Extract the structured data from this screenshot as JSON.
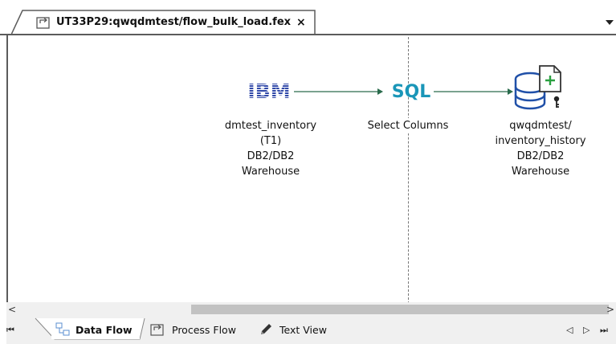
{
  "document_tab": {
    "title": "UT33P29:qwqdmtest/flow_bulk_load.fex",
    "close_label": "×",
    "icon": "flow-document-icon"
  },
  "strip_dropdown": "▾",
  "flow": {
    "source": {
      "icon": "ibm-db2-logo-icon",
      "logo_text": "IBM",
      "lines": [
        "dmtest_inventory",
        "(T1)",
        "DB2/DB2",
        "Warehouse"
      ]
    },
    "transform": {
      "icon": "sql-icon",
      "logo_text": "SQL",
      "lines": [
        "Select Columns"
      ]
    },
    "target": {
      "icon": "database-target-icon",
      "lines": [
        "qwqdmtest/",
        "inventory_history",
        "DB2/DB2",
        "Warehouse"
      ]
    },
    "colors": {
      "ibm_blue": "#3048a8",
      "sql_teal": "#1a96b8",
      "db_blue": "#2050a8",
      "arrow": "#2a6b4c",
      "plus_green": "#2aa040"
    }
  },
  "scrollbar": {
    "left": "<",
    "right": ">"
  },
  "bottom_tabs": [
    {
      "label": "Data Flow",
      "icon": "data-flow-icon",
      "active": true
    },
    {
      "label": "Process Flow",
      "icon": "process-flow-icon",
      "active": false
    },
    {
      "label": "Text View",
      "icon": "pencil-icon",
      "active": false
    }
  ],
  "nav": {
    "first": "⏮",
    "prev": "◁",
    "next": "▷",
    "last": "⏭"
  }
}
